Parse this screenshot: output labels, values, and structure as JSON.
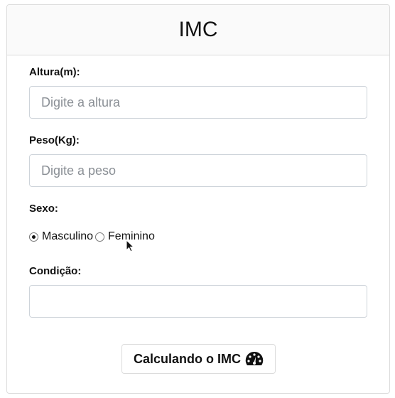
{
  "header": {
    "title": "IMC"
  },
  "form": {
    "altura": {
      "label": "Altura(m):",
      "placeholder": "Digite a altura",
      "value": ""
    },
    "peso": {
      "label": "Peso(Kg):",
      "placeholder": "Digite a peso",
      "value": ""
    },
    "sexo": {
      "label": "Sexo:",
      "options": [
        {
          "label": "Masculino",
          "selected": true
        },
        {
          "label": "Feminino",
          "selected": false
        }
      ]
    },
    "condicao": {
      "label": "Condição:",
      "value": ""
    },
    "submit": {
      "label": "Calculando o IMC",
      "icon": "tachometer-icon"
    }
  }
}
